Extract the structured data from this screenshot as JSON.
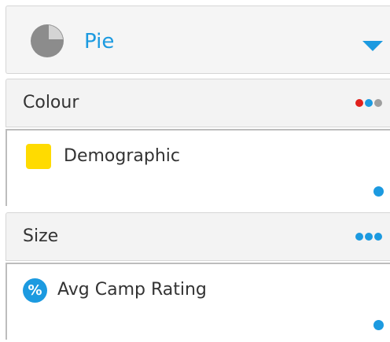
{
  "chart_type": {
    "label": "Pie",
    "icon": "pie-chart-icon",
    "accent": "#1c9ae0"
  },
  "colour": {
    "title": "Colour",
    "dots": [
      "#e0201c",
      "#1c9ae0",
      "#9e9e9e"
    ],
    "field": {
      "label": "Demographic",
      "swatch": "#ffdb00"
    }
  },
  "size": {
    "title": "Size",
    "dots": [
      "#1c9ae0",
      "#1c9ae0",
      "#1c9ae0"
    ],
    "field": {
      "label": "Avg Camp Rating",
      "icon_text": "%"
    }
  }
}
